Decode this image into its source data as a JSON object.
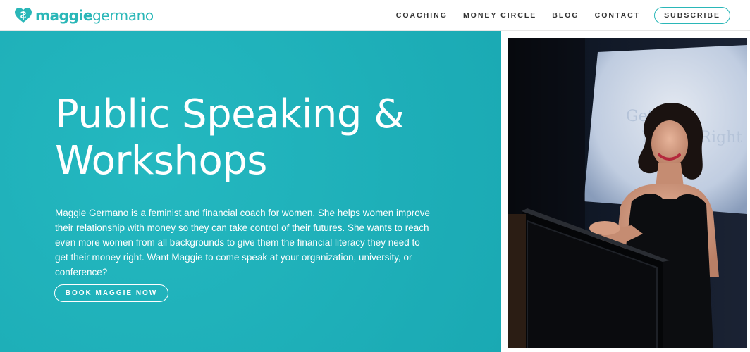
{
  "header": {
    "logo": {
      "first": "maggie",
      "last": "germano",
      "icon": "heart-logo-icon"
    },
    "nav": [
      {
        "label": "COACHING"
      },
      {
        "label": "MONEY CIRCLE"
      },
      {
        "label": "BLOG"
      },
      {
        "label": "CONTACT"
      }
    ],
    "subscribe_label": "SUBSCRIBE"
  },
  "hero": {
    "title_line1": "Public Speaking &",
    "title_line2": "Workshops",
    "description": "Maggie Germano is a feminist and financial coach for women. She helps women improve their relationship with money so they can take control of their futures. She wants to reach even more women from all backgrounds to give them the financial literacy they need to get their money right. Want Maggie to come speak at your organization, university, or conference?",
    "button_label": "BOOK MAGGIE NOW"
  },
  "colors": {
    "accent": "#2ab7b8",
    "hero_bg": "#1eb0b9"
  }
}
